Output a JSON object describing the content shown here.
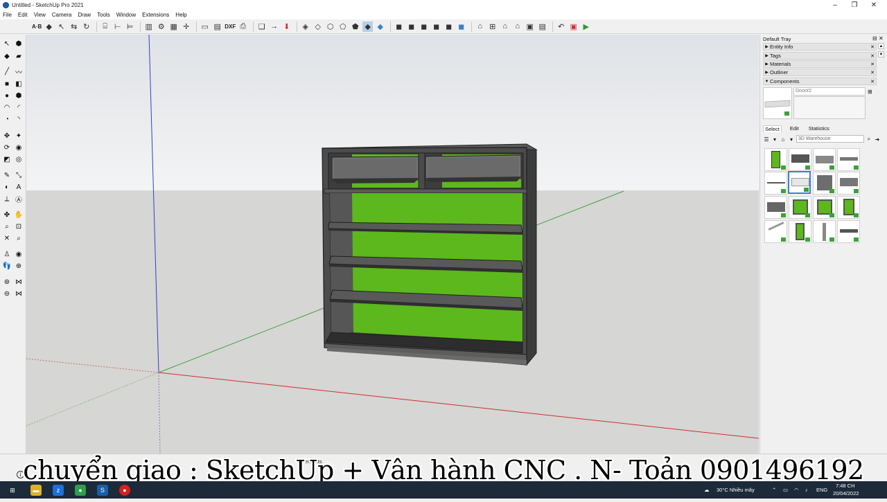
{
  "window": {
    "title": "Untitled - SketchUp Pro 2021",
    "minimize": "–",
    "maximize": "❐",
    "close": "✕"
  },
  "menu": [
    "File",
    "Edit",
    "View",
    "Camera",
    "Draw",
    "Tools",
    "Window",
    "Extensions",
    "Help"
  ],
  "toolbar": {
    "ab_label": "A·B",
    "dxf_label": "DXF"
  },
  "tray": {
    "title": "Default Tray",
    "pin": "⊟",
    "close": "✕",
    "panels": [
      {
        "label": "Entity Info",
        "expanded": false
      },
      {
        "label": "Tags",
        "expanded": false
      },
      {
        "label": "Materials",
        "expanded": false
      },
      {
        "label": "Outliner",
        "expanded": false
      },
      {
        "label": "Components",
        "expanded": true
      }
    ],
    "component_name": "Door#2",
    "tabs": [
      "Select",
      "Edit",
      "Statistics"
    ],
    "active_tab": "Select",
    "search_placeholder": "3D Warehouse"
  },
  "status": {
    "hint": "ements"
  },
  "caption": "chuyển giao : SketchUp + Vận hành CNC . N- Toản 0901496192",
  "taskbar": {
    "weather": "30°C  Nhiều mây",
    "lang": "ENG",
    "time": "7:48 CH",
    "date": "20/04/2022"
  },
  "colors": {
    "accent_green": "#5cb81c",
    "cabinet_dark": "#4a4a4a",
    "sky": "#e8ebee",
    "ground": "#d6d6d4"
  }
}
